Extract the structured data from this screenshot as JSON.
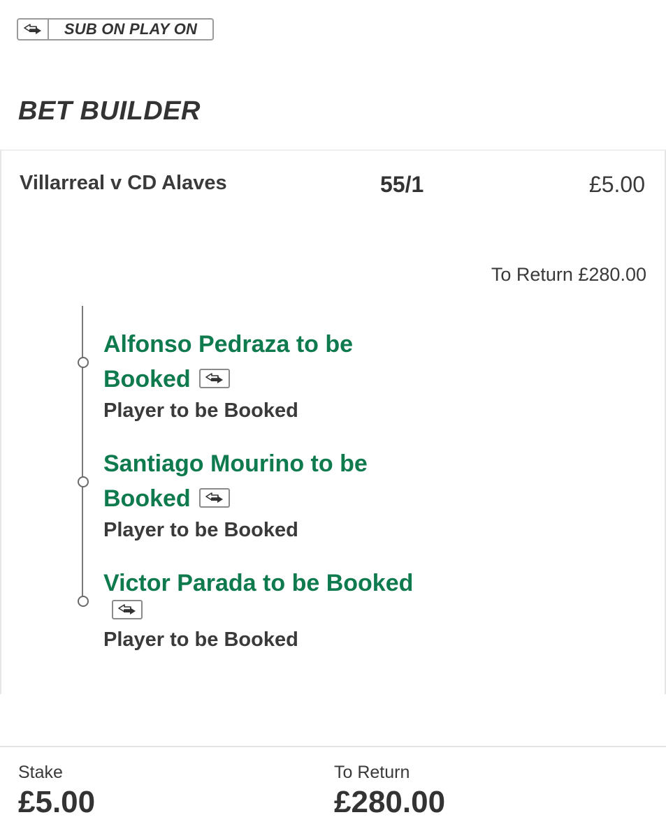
{
  "badge": {
    "icon": "swap-arrows-icon",
    "label": "SUB ON PLAY ON"
  },
  "section": {
    "title": "BET BUILDER"
  },
  "bet": {
    "match": "Villarreal v CD Alaves",
    "odds": "55/1",
    "stake": "£5.00",
    "to_return": "To Return £280.00",
    "legs": [
      {
        "line1": "Alfonso Pedraza to be",
        "line2": "Booked",
        "market": "Player to be Booked",
        "icon": "swap-arrows-icon"
      },
      {
        "line1": "Santiago Mourino to be",
        "line2": "Booked",
        "market": "Player to be Booked",
        "icon": "swap-arrows-icon"
      },
      {
        "line1": "Victor Parada to be Booked",
        "market": "Player to be Booked",
        "icon": "swap-arrows-icon"
      }
    ]
  },
  "footer": {
    "stake_label": "Stake",
    "stake_value": "£5.00",
    "return_label": "To Return",
    "return_value": "£280.00"
  },
  "colors": {
    "selection_green": "#0e7a4e",
    "text_dark": "#333333",
    "border_gray": "#9a9a9a"
  }
}
